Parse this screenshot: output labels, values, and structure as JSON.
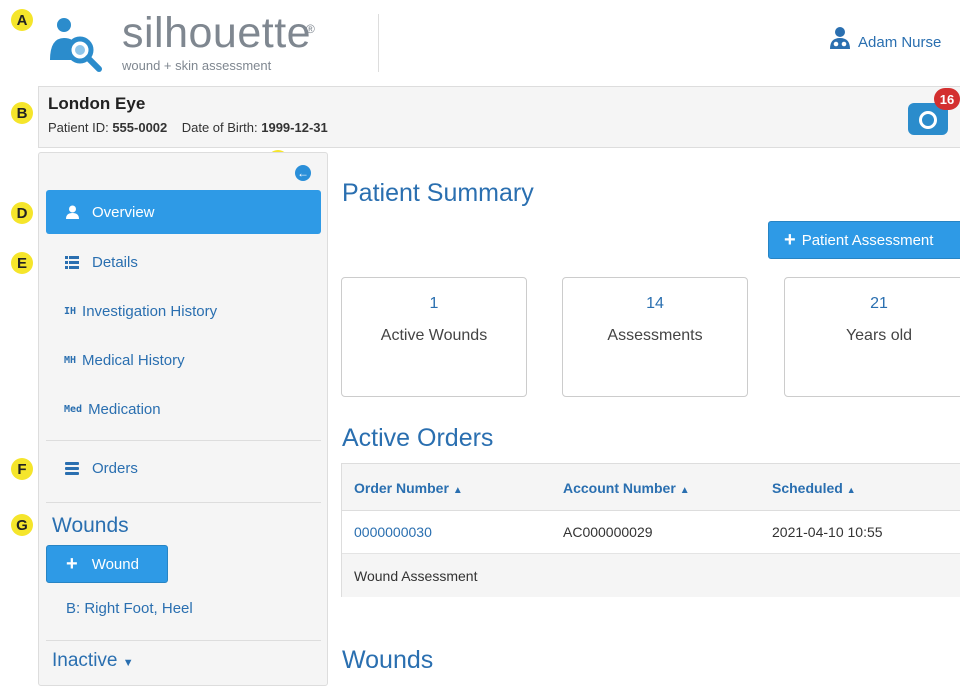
{
  "markers": [
    "A",
    "B",
    "C",
    "D",
    "E",
    "F",
    "G"
  ],
  "header": {
    "logo_word": "silhouette",
    "logo_reg": "®",
    "logo_sub": "wound + skin assessment",
    "user_name": "Adam Nurse",
    "user_icon": "nurse-user-icon"
  },
  "patient": {
    "name": "London Eye",
    "id_label": "Patient ID:",
    "id": "555-0002",
    "dob_label": "Date of Birth:",
    "dob": "1999-12-31",
    "photo_count": "16"
  },
  "sidebar": {
    "collapse_icon": "arrow-left-circle-icon",
    "items": [
      {
        "label": "Overview",
        "icon": "user-icon"
      },
      {
        "label": "Details",
        "icon": "list-icon"
      },
      {
        "label": "Investigation History",
        "abbr": "IH"
      },
      {
        "label": "Medical History",
        "abbr": "MH"
      },
      {
        "label": "Medication",
        "abbr": "Med"
      },
      {
        "label": "Orders",
        "icon": "server-icon"
      }
    ],
    "wounds_heading": "Wounds",
    "wound_button": "Wound",
    "wound_link": "B: Right Foot, Heel",
    "inactive_label": "Inactive"
  },
  "main": {
    "summary_title": "Patient Summary",
    "assessment_button": "Patient Assessment",
    "cards": [
      {
        "value": "1",
        "label": "Active Wounds"
      },
      {
        "value": "14",
        "label": "Assessments"
      },
      {
        "value": "21",
        "label": "Years old"
      }
    ],
    "orders_title": "Active Orders",
    "orders_columns": [
      "Order Number",
      "Account Number",
      "Scheduled"
    ],
    "orders_rows": [
      {
        "order_number": "0000000030",
        "account_number": "AC000000029",
        "scheduled": "2021-04-10 10:55"
      }
    ],
    "orders_detail": "Wound Assessment",
    "wounds_title": "Wounds"
  },
  "colors": {
    "accent": "#2e9ae6",
    "link": "#2a6fb0",
    "badge": "#d32f2f",
    "marker": "#f5e52b"
  }
}
